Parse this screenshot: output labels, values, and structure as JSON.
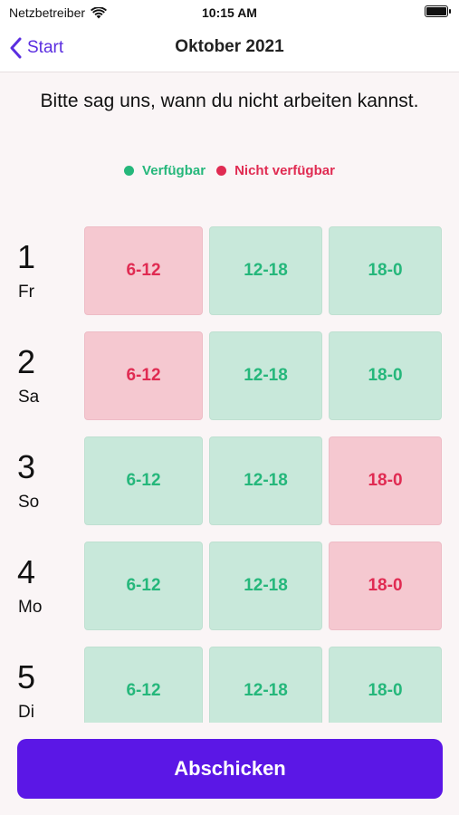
{
  "status_bar": {
    "carrier": "Netzbetreiber",
    "time": "10:15 AM",
    "battery_level": 1.0
  },
  "nav": {
    "back_label": "Start",
    "title": "Oktober 2021"
  },
  "intro_text": "Bitte sag uns, wann du nicht arbeiten kannst.",
  "legend": {
    "available": {
      "label": "Verfügbar",
      "color": "#25b77b"
    },
    "unavailable": {
      "label": "Nicht verfügbar",
      "color": "#e02b52"
    }
  },
  "slot_labels": [
    "6-12",
    "12-18",
    "18-0"
  ],
  "days": [
    {
      "num": "1",
      "name": "Fr",
      "slots": [
        {
          "label": "6-12",
          "status": "unavailable"
        },
        {
          "label": "12-18",
          "status": "available"
        },
        {
          "label": "18-0",
          "status": "available"
        }
      ]
    },
    {
      "num": "2",
      "name": "Sa",
      "slots": [
        {
          "label": "6-12",
          "status": "unavailable"
        },
        {
          "label": "12-18",
          "status": "available"
        },
        {
          "label": "18-0",
          "status": "available"
        }
      ]
    },
    {
      "num": "3",
      "name": "So",
      "slots": [
        {
          "label": "6-12",
          "status": "available"
        },
        {
          "label": "12-18",
          "status": "available"
        },
        {
          "label": "18-0",
          "status": "unavailable"
        }
      ]
    },
    {
      "num": "4",
      "name": "Mo",
      "slots": [
        {
          "label": "6-12",
          "status": "available"
        },
        {
          "label": "12-18",
          "status": "available"
        },
        {
          "label": "18-0",
          "status": "unavailable"
        }
      ]
    },
    {
      "num": "5",
      "name": "Di",
      "slots": [
        {
          "label": "6-12",
          "status": "available"
        },
        {
          "label": "12-18",
          "status": "available"
        },
        {
          "label": "18-0",
          "status": "available"
        }
      ]
    }
  ],
  "submit_label": "Abschicken"
}
